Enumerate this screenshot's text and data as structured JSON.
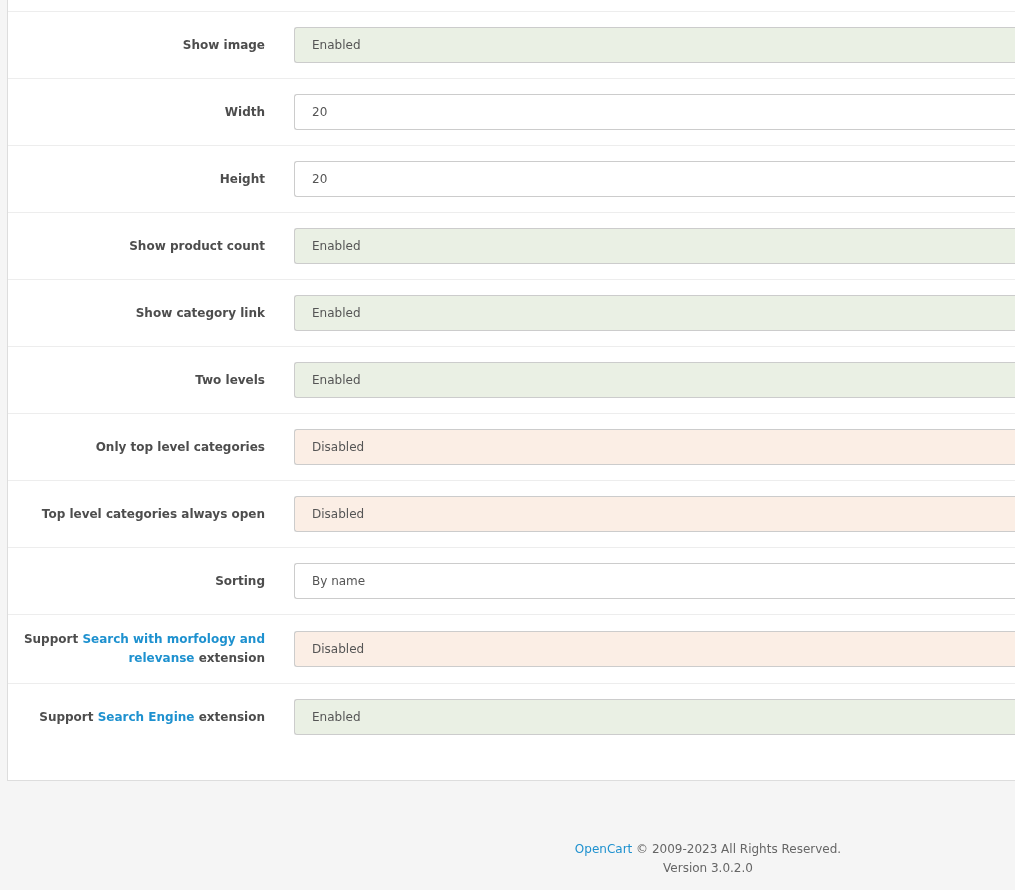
{
  "settings": [
    {
      "label": [
        [
          {
            "kind": "text",
            "text": "Show image"
          }
        ]
      ],
      "kind": "toggle",
      "on": true,
      "value": "Enabled"
    },
    {
      "label": [
        [
          {
            "kind": "text",
            "text": "Width"
          }
        ]
      ],
      "kind": "text",
      "value": "20"
    },
    {
      "label": [
        [
          {
            "kind": "text",
            "text": "Height"
          }
        ]
      ],
      "kind": "text",
      "value": "20"
    },
    {
      "label": [
        [
          {
            "kind": "text",
            "text": "Show product count"
          }
        ]
      ],
      "kind": "toggle",
      "on": true,
      "value": "Enabled"
    },
    {
      "label": [
        [
          {
            "kind": "text",
            "text": "Show category link"
          }
        ]
      ],
      "kind": "toggle",
      "on": true,
      "value": "Enabled"
    },
    {
      "label": [
        [
          {
            "kind": "text",
            "text": "Two levels"
          }
        ]
      ],
      "kind": "toggle",
      "on": true,
      "value": "Enabled"
    },
    {
      "label": [
        [
          {
            "kind": "text",
            "text": "Only top level categories"
          }
        ]
      ],
      "kind": "toggle",
      "on": false,
      "value": "Disabled"
    },
    {
      "label": [
        [
          {
            "kind": "text",
            "text": "Top level categories always open"
          }
        ]
      ],
      "kind": "toggle",
      "on": false,
      "value": "Disabled"
    },
    {
      "label": [
        [
          {
            "kind": "text",
            "text": "Sorting"
          }
        ]
      ],
      "kind": "select",
      "value": "By name"
    },
    {
      "label": [
        [
          {
            "kind": "text",
            "text": "Support "
          },
          {
            "kind": "link",
            "text": "Search with morfology and"
          }
        ],
        [
          {
            "kind": "link",
            "text": "relevanse"
          },
          {
            "kind": "text",
            "text": " extension"
          }
        ]
      ],
      "kind": "toggle",
      "on": false,
      "value": "Disabled"
    },
    {
      "label": [
        [
          {
            "kind": "text",
            "text": "Support "
          },
          {
            "kind": "link",
            "text": "Search Engine"
          },
          {
            "kind": "text",
            "text": " extension"
          }
        ]
      ],
      "kind": "toggle",
      "on": true,
      "value": "Enabled"
    }
  ],
  "footer": {
    "link": "OpenCart",
    "copyright": " © 2009-2023 All Rights Reserved.",
    "version": "Version 3.0.2.0"
  }
}
